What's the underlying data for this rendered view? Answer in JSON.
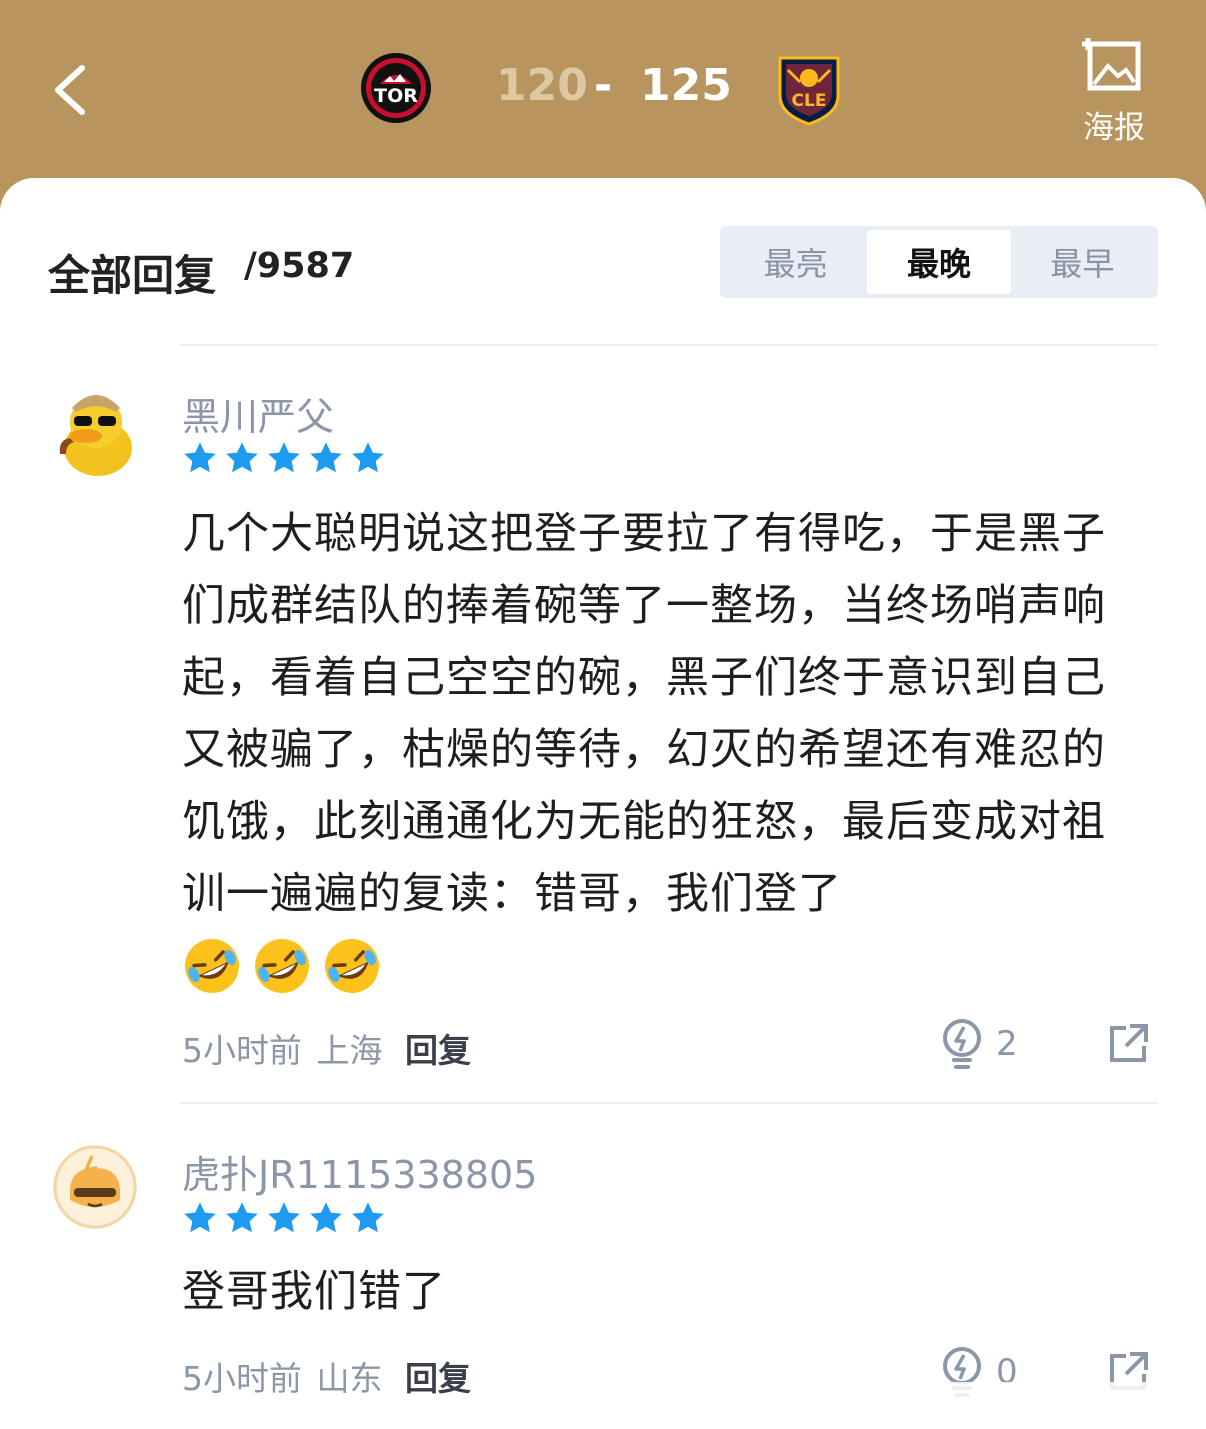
{
  "header": {
    "home_team": "TOR",
    "away_team": "CLE",
    "home_score": "120",
    "score_separator": "-",
    "away_score": "125",
    "poster_label": "海报",
    "colors": {
      "header_bg": "#b8955e",
      "tor_red": "#c8102e",
      "cle_wine": "#6f263d",
      "cle_gold": "#ffb81c"
    }
  },
  "replies": {
    "title": "全部回复",
    "count": "/9587",
    "sort_tabs": [
      {
        "label": "最亮"
      },
      {
        "label": "最晚"
      },
      {
        "label": "最早"
      }
    ],
    "active_tab": "最晚"
  },
  "comments": [
    {
      "username": "黑川严父",
      "avatar_icon": "duck-detective-avatar",
      "stars": 5,
      "text": "几个大聪明说这把登子要拉了有得吃，于是黑子们成群结队的捧着碗等了一整场，当终场哨声响起，看着自己空空的碗，黑子们终于意识到自己又被骗了，枯燥的等待，幻灭的希望还有难忍的饥饿，此刻通通化为无能的狂怒，最后变成对祖训一遍遍的复读：错哥，我们登了",
      "emojis": [
        "rofl-emoji",
        "rofl-emoji",
        "rofl-emoji"
      ],
      "time": "5小时前",
      "location": "上海",
      "reply_label": "回复",
      "likes": "2"
    },
    {
      "username": "虎扑JR1115338805",
      "avatar_icon": "default-sunglasses-avatar",
      "stars": 5,
      "text": "登哥我们错了",
      "time": "5小时前",
      "location": "山东",
      "reply_label": "回复",
      "likes": "0"
    }
  ]
}
